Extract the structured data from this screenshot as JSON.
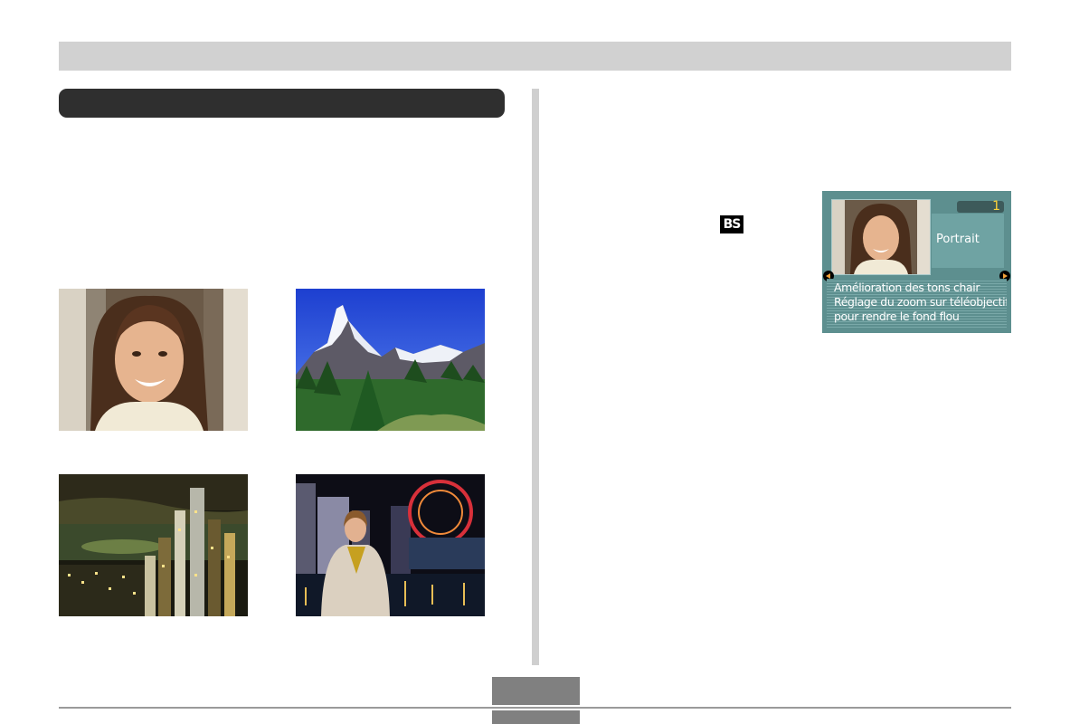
{
  "icons": {
    "bs_icon": "BS"
  },
  "photos": [
    {
      "subject": "portrait-woman"
    },
    {
      "subject": "mountain-landscape"
    },
    {
      "subject": "night-city-scene"
    },
    {
      "subject": "night-portrait"
    }
  ],
  "lcd": {
    "counter": "1",
    "mode_label": "Portrait",
    "description_lines": [
      "Amélioration des tons chair",
      "Réglage du zoom sur téléobjectif",
      "pour rendre le fond flou"
    ]
  },
  "colors": {
    "header_bar": "#d1d1d1",
    "section_bar": "#2f2f2f",
    "lcd_background": "#5d8f8f",
    "lcd_counter_text": "#ffd338",
    "lcd_arrow": "#f2a23a"
  }
}
